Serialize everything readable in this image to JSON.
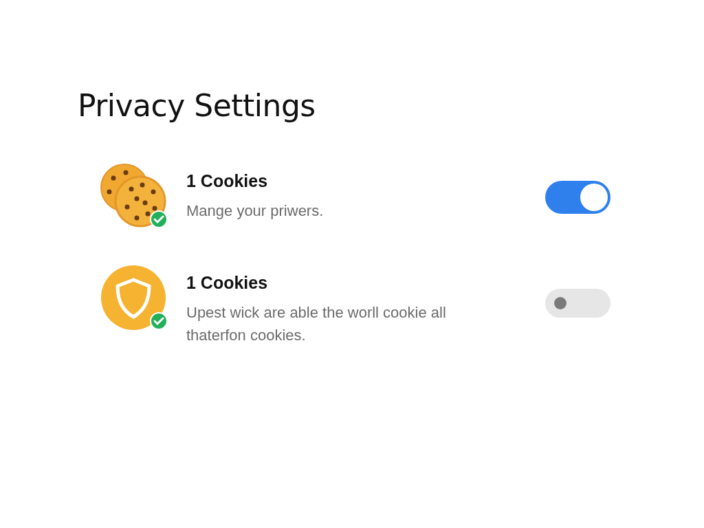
{
  "title": "Privacy Settings",
  "settings": [
    {
      "kind": "cookie",
      "verified": true,
      "title": "1 Cookies",
      "description": "Mange your priwers.",
      "on": true
    },
    {
      "kind": "shield",
      "verified": true,
      "title": "1 Cookies",
      "description": "Upest wick are able the worll cookie all thaterfon cookies.",
      "on": false
    }
  ]
}
